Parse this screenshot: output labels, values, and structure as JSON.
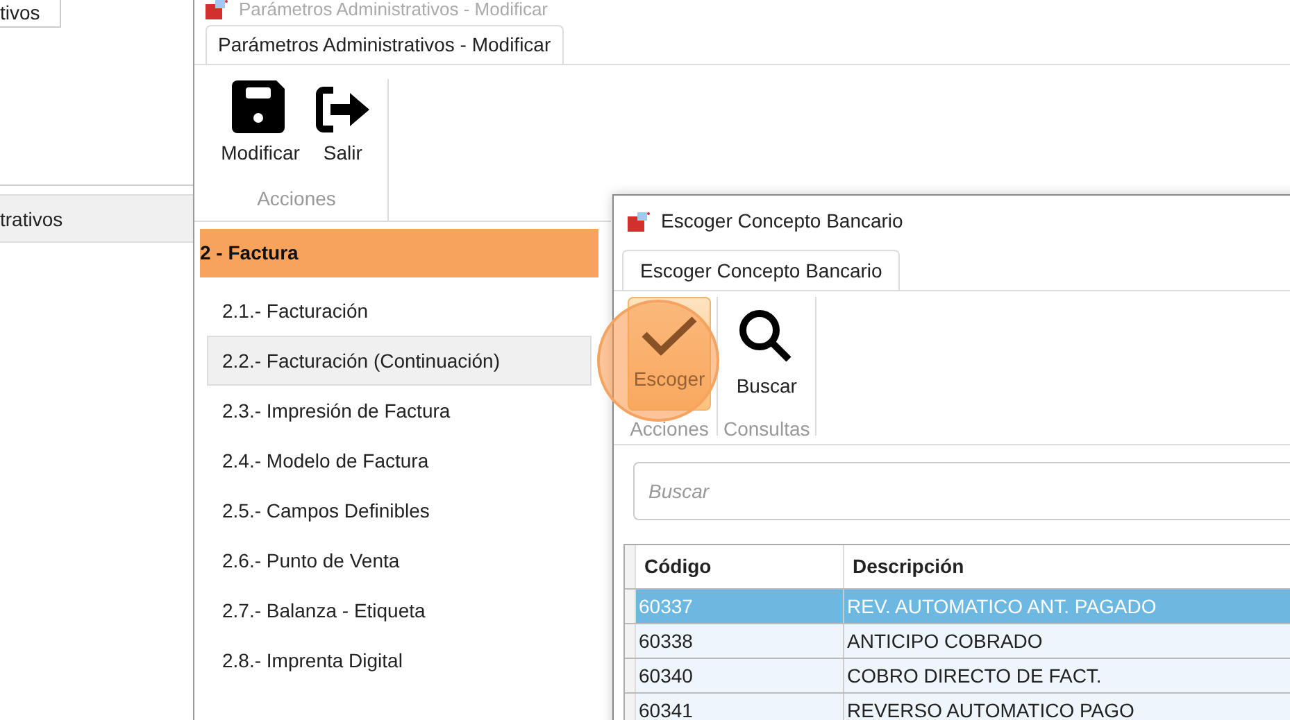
{
  "background_window": {
    "tab": "tivos",
    "row": "trativos"
  },
  "main_window": {
    "title": "Parámetros Administrativos - Modificar",
    "tab": "Parámetros Administrativos - Modificar",
    "toolbar": {
      "buttons": [
        {
          "label": "Modificar",
          "kind": "save"
        },
        {
          "label": "Salir",
          "kind": "exit"
        }
      ],
      "group": "Acciones"
    },
    "section": "2 - Factura",
    "items": [
      {
        "label": "2.1.- Facturación",
        "selected": false
      },
      {
        "label": "2.2.- Facturación (Continuación)",
        "selected": true
      },
      {
        "label": "2.3.- Impresión de Factura",
        "selected": false
      },
      {
        "label": "2.4.- Modelo de Factura",
        "selected": false
      },
      {
        "label": "2.5.- Campos Definibles",
        "selected": false
      },
      {
        "label": "2.6.- Punto de Venta",
        "selected": false
      },
      {
        "label": "2.7.- Balanza - Etiqueta",
        "selected": false
      },
      {
        "label": "2.8.- Imprenta Digital",
        "selected": false
      }
    ]
  },
  "dialog": {
    "title": "Escoger Concepto Bancario",
    "tab": "Escoger Concepto Bancario",
    "groups": [
      {
        "label": "Acciones",
        "buttons": [
          {
            "label": "Escoger",
            "kind": "check",
            "hovered": true
          }
        ]
      },
      {
        "label": "Consultas",
        "buttons": [
          {
            "label": "Buscar",
            "kind": "search",
            "hovered": false
          }
        ]
      }
    ],
    "search": {
      "placeholder": "Buscar"
    },
    "table": {
      "columns": [
        "Código",
        "Descripción"
      ],
      "rows": [
        {
          "cells": [
            "60337",
            "REV. AUTOMATICO ANT. PAGADO"
          ],
          "selected": true
        },
        {
          "cells": [
            "60338",
            "ANTICIPO COBRADO"
          ],
          "selected": false
        },
        {
          "cells": [
            "60340",
            "COBRO DIRECTO DE FACT."
          ],
          "selected": false
        },
        {
          "cells": [
            "60341",
            "REVERSO AUTOMATICO PAGO"
          ],
          "selected": false
        }
      ]
    }
  }
}
